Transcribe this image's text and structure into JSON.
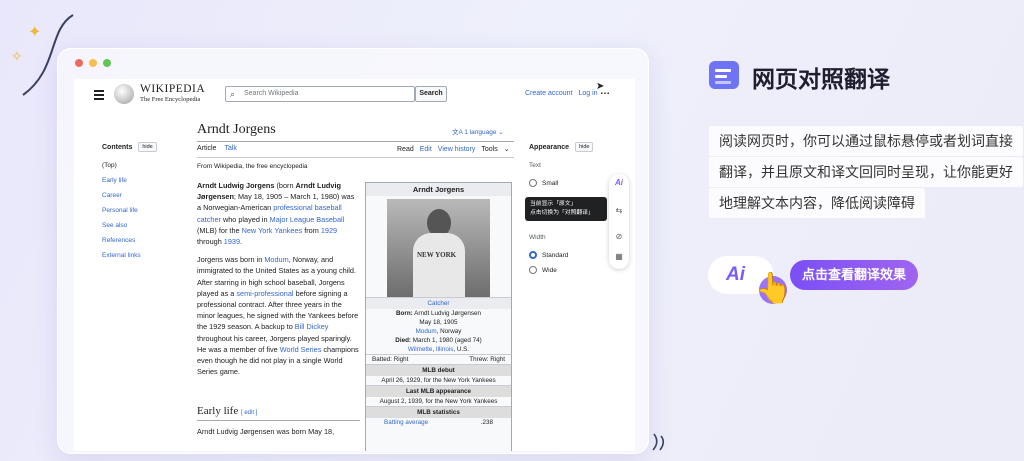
{
  "browser": {
    "dot_colors": [
      "#ee6a5e",
      "#f5bf4f",
      "#61c554"
    ]
  },
  "wiki": {
    "logo_title": "WIKIPEDIA",
    "logo_subtitle": "The Free Encyclopedia",
    "search_placeholder": "Search Wikipedia",
    "search_button": "Search",
    "create_account": "Create account",
    "login": "Log in",
    "more_icon": "…"
  },
  "toc": {
    "title": "Contents",
    "hide": "hide",
    "items": [
      "(Top)",
      "Early life",
      "Career",
      "Personal life",
      "See also",
      "References",
      "External links"
    ]
  },
  "article": {
    "title": "Arndt Jorgens",
    "language": "1 language",
    "tab_article": "Article",
    "tab_talk": "Talk",
    "tab_read": "Read",
    "tab_edit": "Edit",
    "tab_history": "View history",
    "tab_tools": "Tools",
    "from": "From Wikipedia, the free encyclopedia",
    "p1": [
      {
        "t": "Arndt Ludwig Jorgens",
        "b": true
      },
      {
        "t": " (born "
      },
      {
        "t": "Arndt Ludvig Jørgensen",
        "b": true
      },
      {
        "t": "; May 18, 1905 – March 1, 1980) was a Norwegian-American "
      },
      {
        "t": "professional baseball",
        "l": true
      },
      {
        "t": " "
      },
      {
        "t": "catcher",
        "l": true
      },
      {
        "t": " who played in "
      },
      {
        "t": "Major League Baseball",
        "l": true
      },
      {
        "t": " (MLB) for the "
      },
      {
        "t": "New York Yankees",
        "l": true
      },
      {
        "t": " from "
      },
      {
        "t": "1929",
        "l": true
      },
      {
        "t": " through "
      },
      {
        "t": "1939",
        "l": true
      },
      {
        "t": "."
      }
    ],
    "p2": [
      {
        "t": "Jorgens was born in "
      },
      {
        "t": "Modum",
        "l": true
      },
      {
        "t": ", Norway, and immigrated to the United States as a young child. After starring in high school baseball, Jorgens played as a "
      },
      {
        "t": "semi-professional",
        "l": true
      },
      {
        "t": " before signing a professional contract. After three years in the minor leagues, he signed with the Yankees before the 1929 season. A backup to "
      },
      {
        "t": "Bill Dickey",
        "l": true
      },
      {
        "t": " throughout his career, Jorgens played sparingly. He was a member of five "
      },
      {
        "t": "World Series",
        "l": true
      },
      {
        "t": " champions even though he did not play in a single World Series game."
      }
    ],
    "section_title": "Early life",
    "section_edit": "[ edit ]",
    "section_text": "Arndt Ludvig Jørgensen was born May 18,"
  },
  "infobox": {
    "header": "Arndt Jorgens",
    "photo_text": "NEW YORK",
    "position": "Catcher",
    "born_label": "Born:",
    "born_1": "Arndt Ludvig Jørgensen",
    "born_2": "May 18, 1905",
    "born_3_link": "Modum",
    "born_3_rest": ", Norway",
    "died_label": "Died:",
    "died_1": "March 1, 1980 (aged 74)",
    "died_2_a": "Wilmette",
    "died_2_b": "Illinois",
    "died_2_c": ", U.S.",
    "batted": "Batted: Right",
    "threw": "Threw: Right",
    "debut_h": "MLB debut",
    "debut": "April 26, 1929, for the New York Yankees",
    "last_h": "Last MLB appearance",
    "last": "August 2, 1939, for the New York Yankees",
    "stats_h": "MLB statistics",
    "stat_label": "Batting average",
    "stat_value": ".238"
  },
  "appearance": {
    "title": "Appearance",
    "hide": "hide",
    "text_label": "Text",
    "small": "Small",
    "width_label": "Width",
    "standard": "Standard",
    "wide": "Wide",
    "tooltip_1": "当前显示「原文」",
    "tooltip_2": "点击切换为「对照翻译」"
  },
  "promo": {
    "title": "网页对照翻译",
    "line1": "阅读网页时，你可以通过鼠标悬停或者划词直接",
    "line2": "翻译，并且原文和译文回同时呈现，让你能更好",
    "line3": "地理解文本内容，降低阅读障碍",
    "ai_badge": "Ai",
    "cta": "点击查看翻译效果",
    "accent": "#7b4ff5"
  }
}
